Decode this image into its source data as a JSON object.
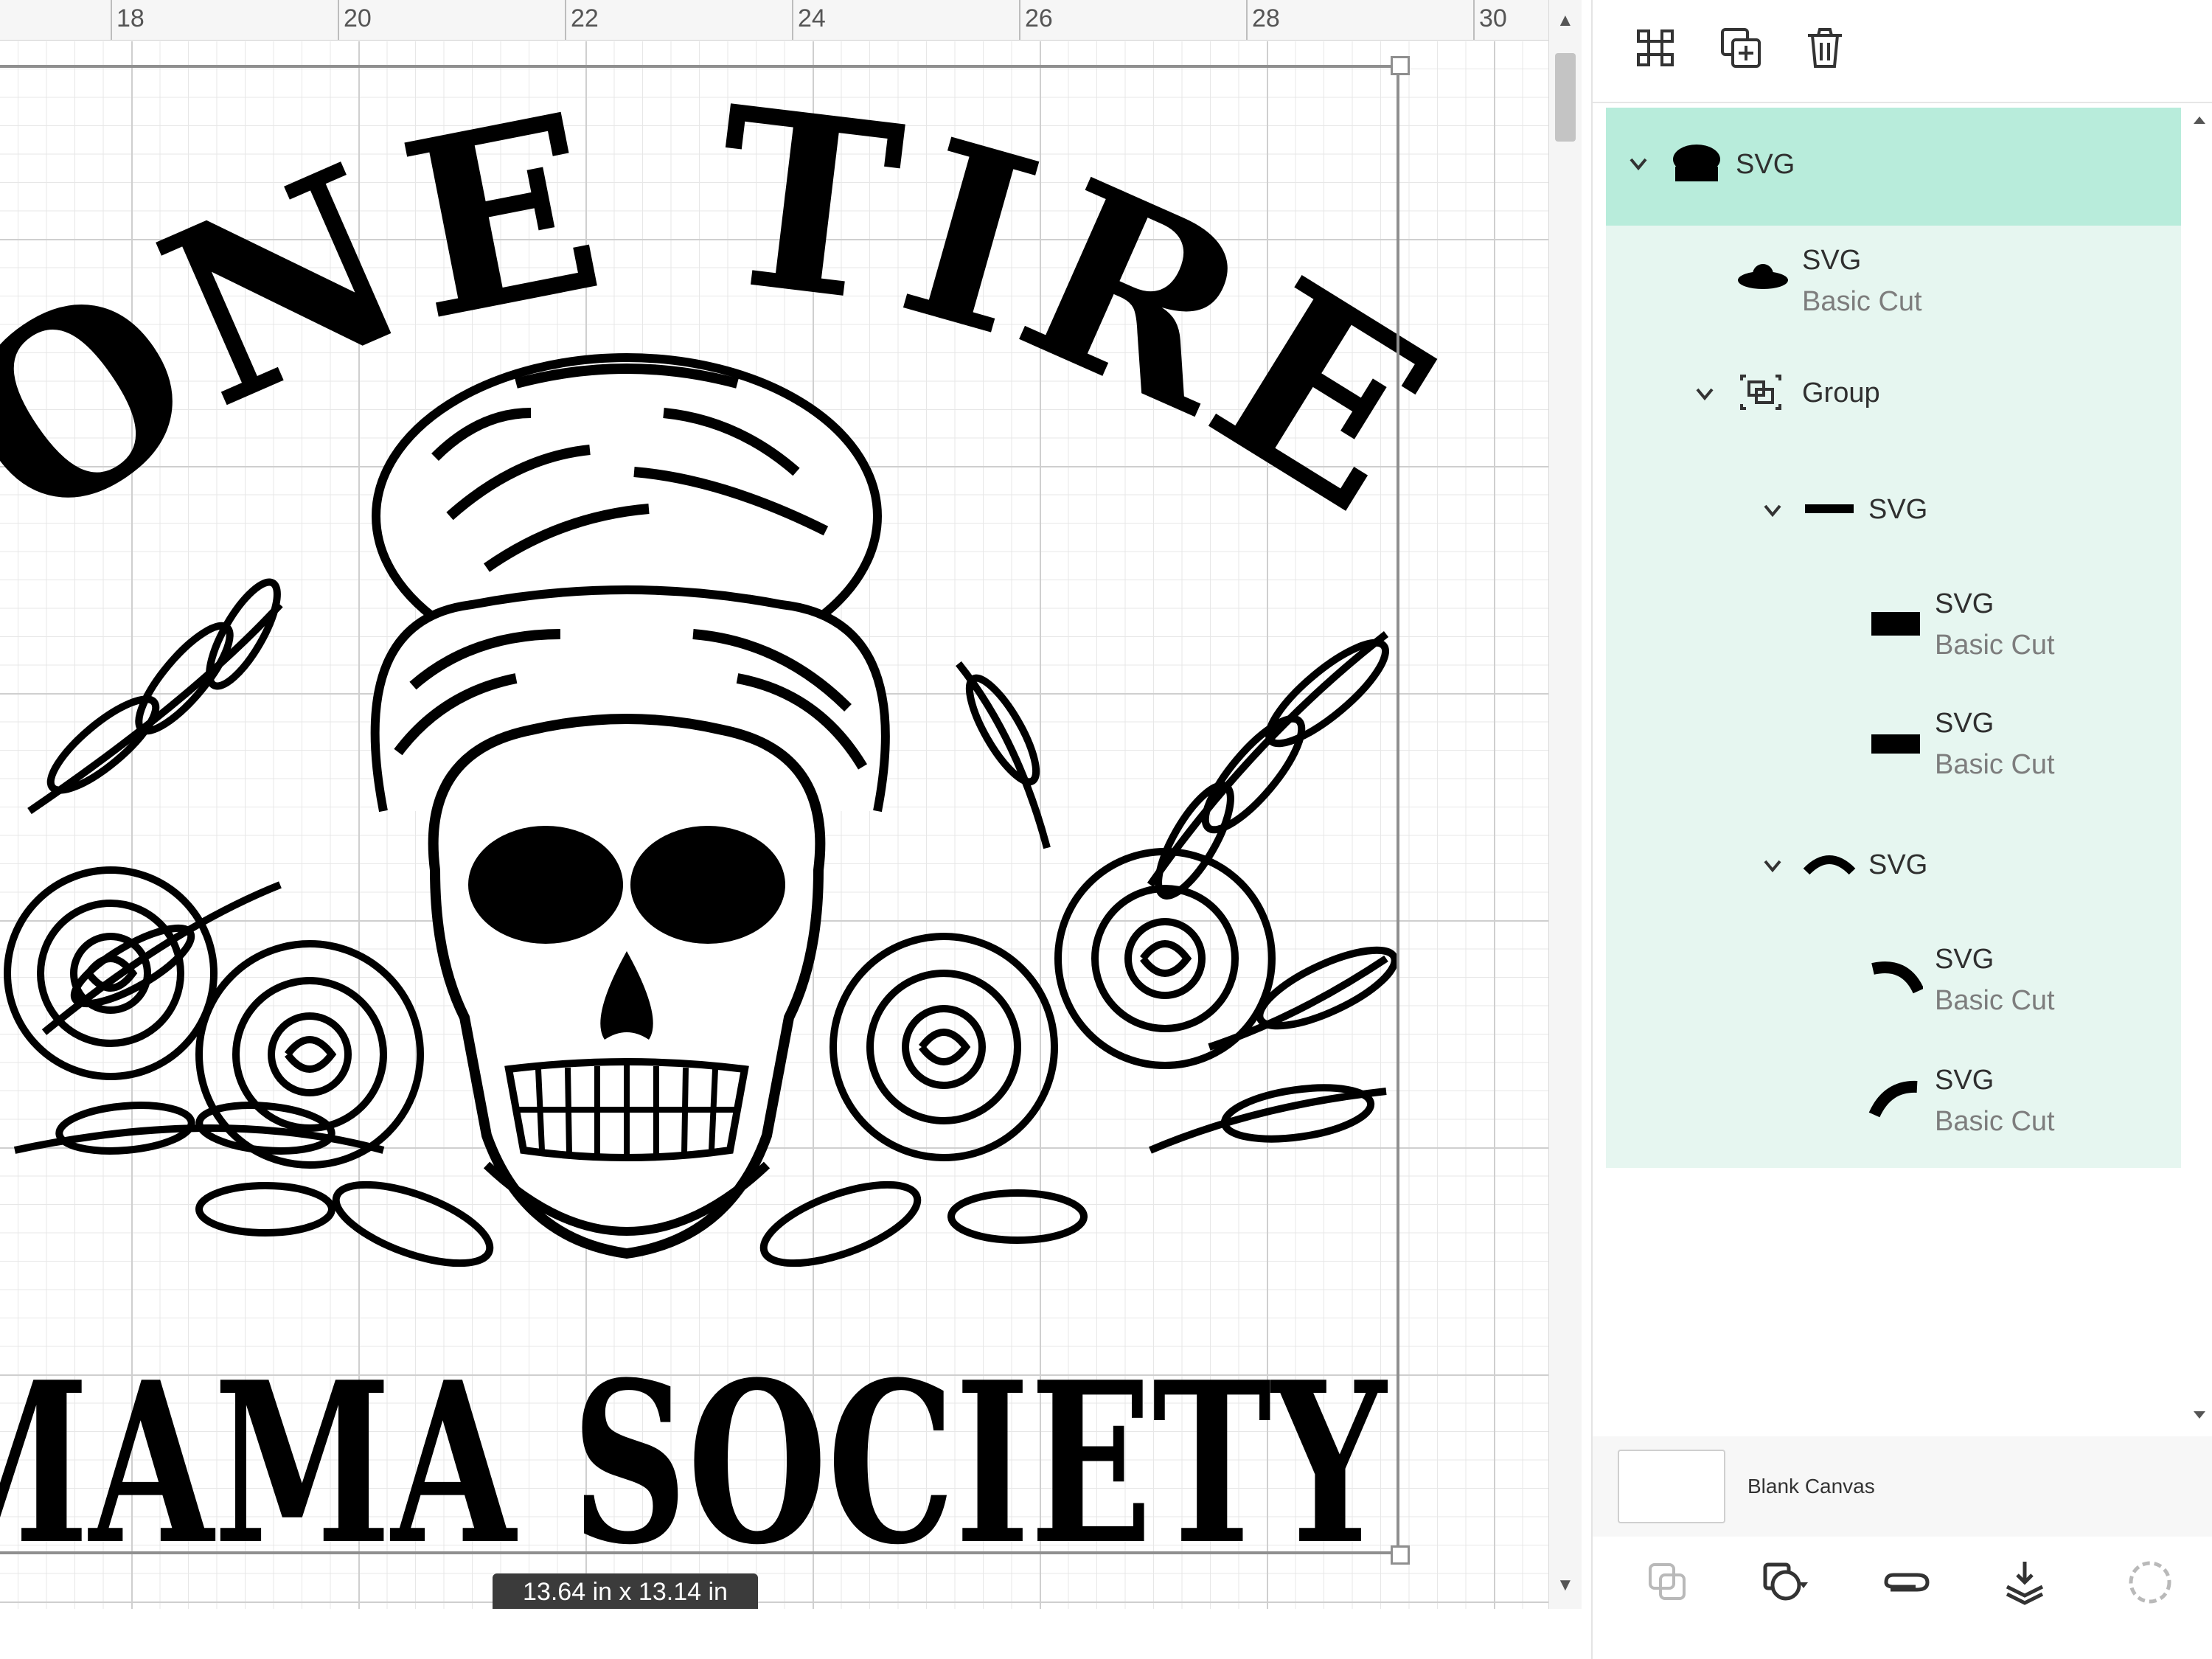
{
  "ruler": {
    "labels": [
      "18",
      "20",
      "22",
      "24",
      "26",
      "28",
      "30"
    ]
  },
  "artwork": {
    "top_text": "BONE TIRED",
    "bottom_text": "MAMA SOCIETY",
    "text_color": "#000000"
  },
  "size_badge": {
    "text": "13.64  in x 13.14  in"
  },
  "toolbar": {
    "icons": [
      "group-ungroup-icon",
      "duplicate-icon",
      "trash-icon"
    ]
  },
  "layers": {
    "accent_color": "#b8ecdb",
    "group_bg_color": "#e6f6f0",
    "items": [
      {
        "name": "SVG",
        "sub": ""
      },
      {
        "name": "SVG",
        "sub": "Basic Cut"
      },
      {
        "name": "Group",
        "sub": ""
      },
      {
        "name": "SVG",
        "sub": ""
      },
      {
        "name": "SVG",
        "sub": "Basic Cut"
      },
      {
        "name": "SVG",
        "sub": "Basic Cut"
      },
      {
        "name": "SVG",
        "sub": ""
      },
      {
        "name": "SVG",
        "sub": "Basic Cut"
      },
      {
        "name": "SVG",
        "sub": "Basic Cut"
      }
    ]
  },
  "blank_canvas": {
    "label": "Blank Canvas"
  },
  "bottom_toolbar": {
    "icons": [
      "slice-icon",
      "combine-icon",
      "attach-icon",
      "flatten-icon",
      "contour-icon"
    ]
  }
}
